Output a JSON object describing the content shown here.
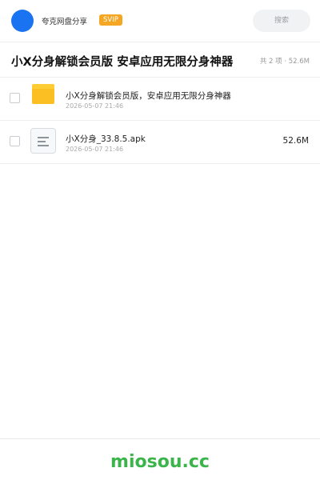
{
  "header": {
    "user_name": "夸克网盘分享",
    "badge": "SVIP",
    "search_placeholder": "搜索"
  },
  "share": {
    "title": "小X分身解锁会员版 安卓应用无限分身神器",
    "summary": "共 2 项 · 52.6M"
  },
  "files": [
    {
      "type": "folder",
      "name": "小X分身解锁会员版，安卓应用无限分身神器",
      "date": "2026-05-07 21:46",
      "size": ""
    },
    {
      "type": "file",
      "name": "小X分身_33.8.5.apk",
      "date": "2026-05-07 21:46",
      "size": "52.6M"
    }
  ],
  "footer": {
    "brand": "miosou.cc"
  },
  "colors": {
    "avatar": "#1a73f0",
    "badge": "#f5a623",
    "brand": "#3bb54a",
    "folder": "#fbbf24"
  }
}
